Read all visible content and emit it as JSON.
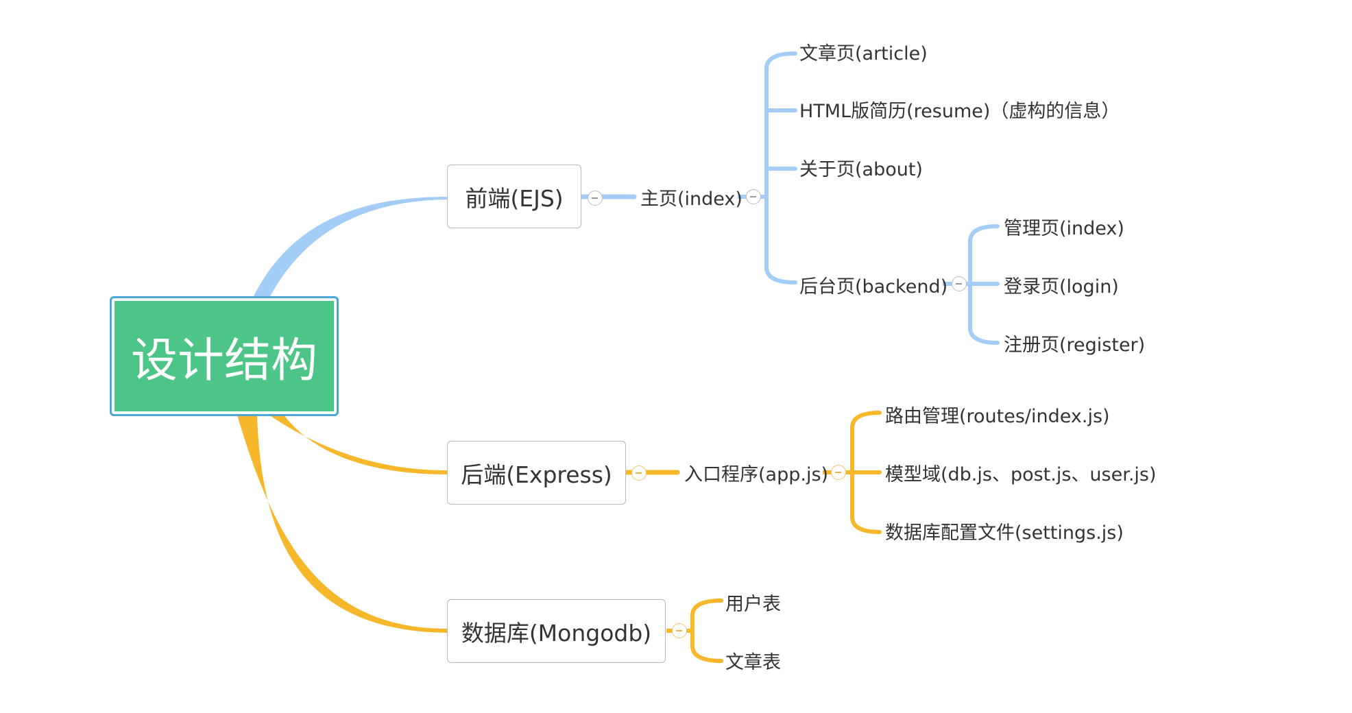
{
  "root": {
    "label": "设计结构"
  },
  "branches": {
    "frontend": {
      "label": "前端(EJS)",
      "index": {
        "label": "主页(index)",
        "article": "文章页(article)",
        "resume": "HTML版简历(resume)（虚构的信息）",
        "about": "关于页(about)",
        "backend": {
          "label": "后台页(backend)",
          "admin_index": "管理页(index)",
          "login": "登录页(login)",
          "register": "注册页(register)"
        }
      }
    },
    "backend": {
      "label": "后端(Express)",
      "entry": {
        "label": "入口程序(app.js)",
        "routes": "路由管理(routes/index.js)",
        "models": "模型域(db.js、post.js、user.js)",
        "settings": "数据库配置文件(settings.js)"
      }
    },
    "database": {
      "label": "数据库(Mongodb)",
      "users": "用户表",
      "articles": "文章表"
    }
  },
  "colors": {
    "root_fill": "#4dc586",
    "root_border": "#4aa7d6",
    "blue_branch": "#a3cdf7",
    "yellow_branch": "#f6b82a",
    "node_border": "#b8b8b8",
    "text": "#333333"
  }
}
